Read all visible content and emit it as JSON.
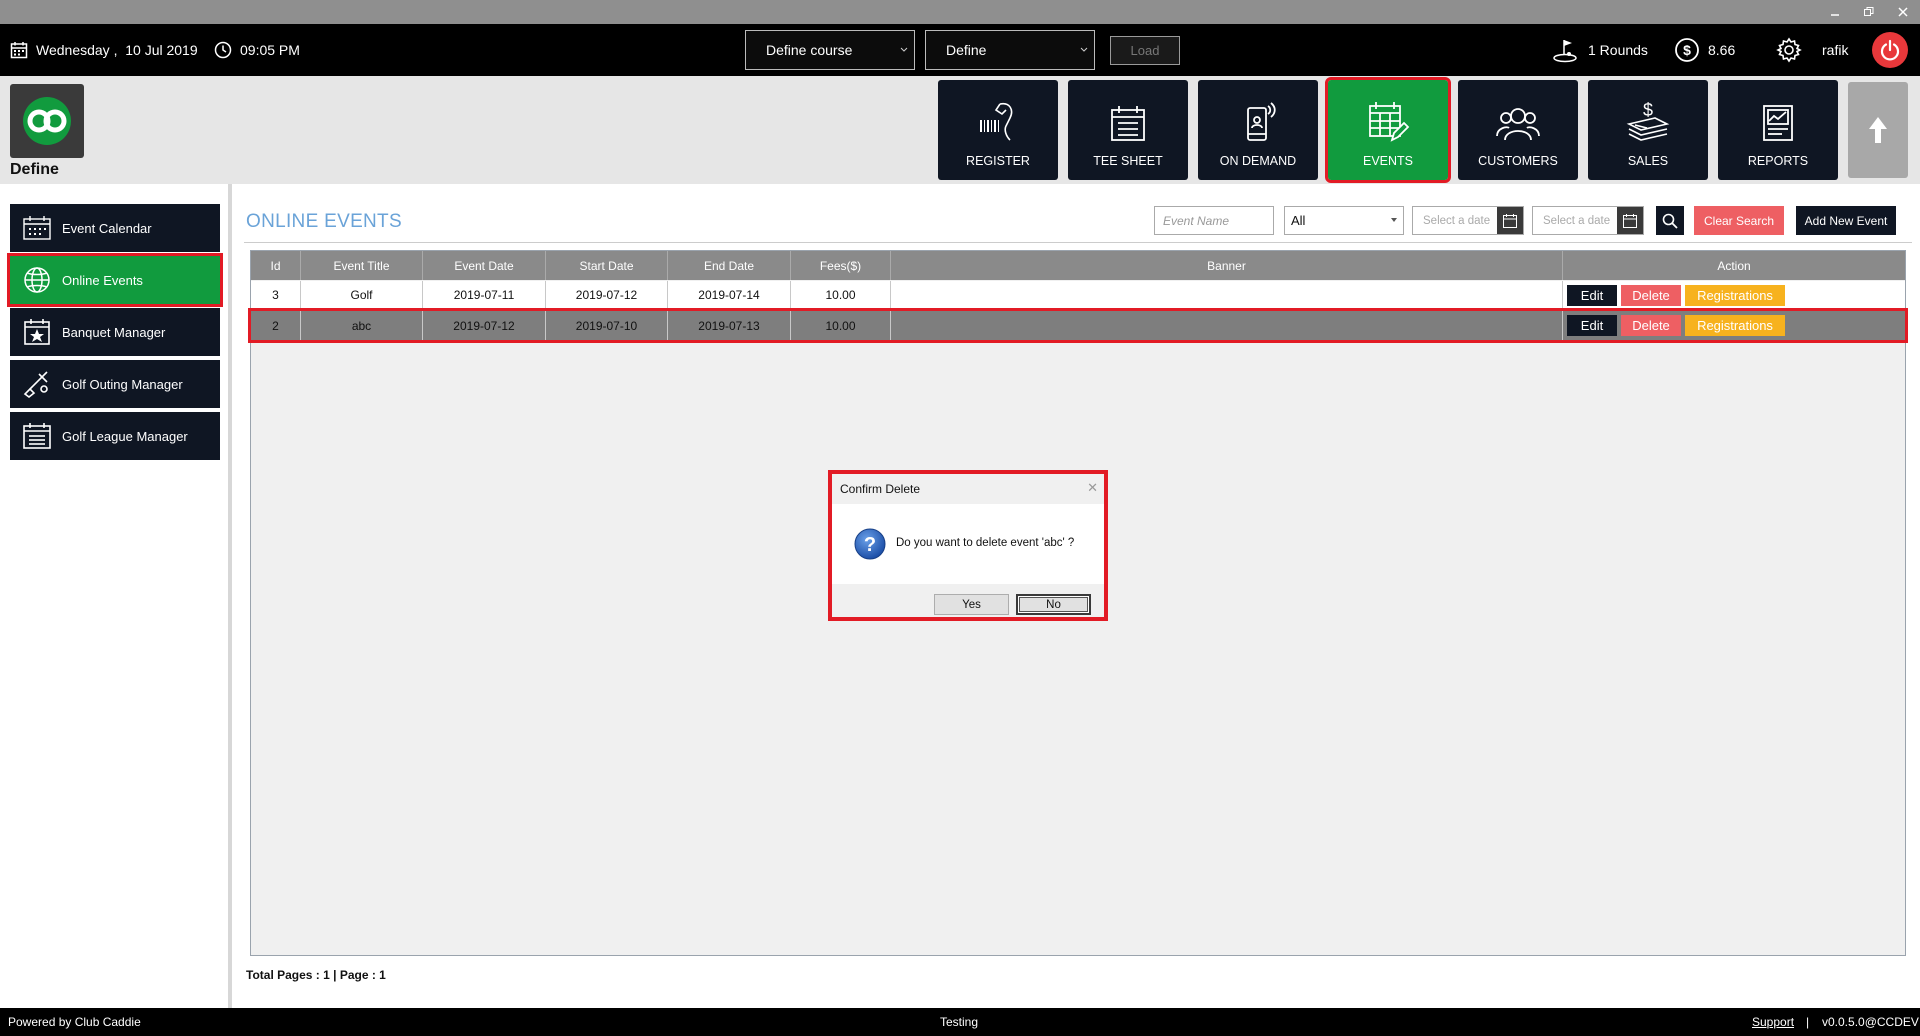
{
  "topbar": {
    "date": "Wednesday ,  10 Jul 2019",
    "time": "09:05 PM",
    "course_select": "Define course",
    "define_select": "Define",
    "load_label": "Load",
    "rounds": "1 Rounds",
    "balance": "8.66",
    "user": "rafik"
  },
  "header": {
    "app_title": "Define",
    "nav": [
      {
        "label": "REGISTER",
        "icon": "barcode-scanner-icon"
      },
      {
        "label": "TEE SHEET",
        "icon": "tee-sheet-icon"
      },
      {
        "label": "ON DEMAND",
        "icon": "mobile-signal-icon"
      },
      {
        "label": "EVENTS",
        "icon": "calendar-edit-icon",
        "active": true
      },
      {
        "label": "CUSTOMERS",
        "icon": "users-icon"
      },
      {
        "label": "SALES",
        "icon": "money-stack-icon"
      },
      {
        "label": "REPORTS",
        "icon": "report-chart-icon"
      }
    ]
  },
  "sidebar": {
    "items": [
      {
        "label": "Event Calendar",
        "icon": "calendar-icon"
      },
      {
        "label": "Online Events",
        "icon": "globe-icon",
        "active": true
      },
      {
        "label": "Banquet Manager",
        "icon": "calendar-star-icon"
      },
      {
        "label": "Golf Outing Manager",
        "icon": "golf-club-icon"
      },
      {
        "label": "Golf League Manager",
        "icon": "list-calendar-icon"
      }
    ]
  },
  "main": {
    "title": "ONLINE EVENTS",
    "filters": {
      "event_name_placeholder": "Event Name",
      "status_value": "All",
      "start_date_placeholder": "Select a date",
      "end_date_placeholder": "Select a date",
      "clear_label": "Clear Search",
      "add_label": "Add New Event"
    },
    "table": {
      "headers": [
        "Id",
        "Event Title",
        "Event Date",
        "Start Date",
        "End Date",
        "Fees($)",
        "Banner",
        "Action"
      ],
      "rows": [
        {
          "id": "3",
          "title": "Golf",
          "event_date": "2019-07-11",
          "start_date": "2019-07-12",
          "end_date": "2019-07-14",
          "fees": "10.00"
        },
        {
          "id": "2",
          "title": "abc",
          "event_date": "2019-07-12",
          "start_date": "2019-07-10",
          "end_date": "2019-07-13",
          "fees": "10.00"
        }
      ],
      "actions": {
        "edit": "Edit",
        "delete": "Delete",
        "registrations": "Registrations"
      }
    },
    "pager": "Total Pages : 1 | Page : 1"
  },
  "dialog": {
    "title": "Confirm Delete",
    "message": "Do you want to delete event 'abc' ?",
    "yes": "Yes",
    "no": "No"
  },
  "footer": {
    "powered_by": "Powered by Club Caddie",
    "env": "Testing",
    "support": "Support",
    "separator": "|",
    "version": "v0.0.5.0@CCDEV"
  },
  "colors": {
    "accent_green": "#119b3e",
    "highlight_red": "#e21b25",
    "navy": "#0f1623",
    "title_blue": "#6aa3d8",
    "delete_red": "#ee5f63",
    "registrations_orange": "#f7b21e"
  }
}
